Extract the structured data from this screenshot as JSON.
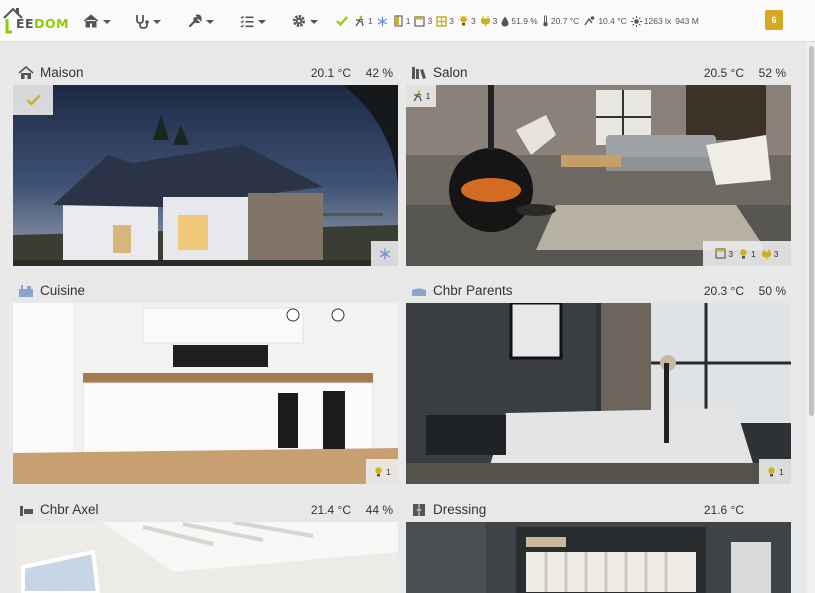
{
  "app": {
    "logo_text_first": "EE",
    "logo_text_rest": "DOM"
  },
  "navbar": {
    "menus": [
      {
        "icon": "home-icon"
      },
      {
        "icon": "stethoscope-icon"
      },
      {
        "icon": "wrench-icon"
      },
      {
        "icon": "checklist-icon"
      },
      {
        "icon": "gear-icon"
      }
    ],
    "summary": {
      "motion_count": "1",
      "door_count": "1",
      "window_count": "3",
      "shutter_count": "3",
      "light_count": "3",
      "outlet_count": "3",
      "humidity": "51.9 %",
      "temperature": "20.7 °C",
      "outdoor_temperature": "10.4 °C",
      "luminosity": "1263 lx",
      "pressure": "943 M"
    },
    "notifications_count": "6"
  },
  "rooms": [
    {
      "name": "Maison",
      "temperature": "20.1 °C",
      "humidity": "42 %"
    },
    {
      "name": "Salon",
      "temperature": "20.5 °C",
      "humidity": "52 %",
      "motion_count": "1",
      "window_count": "3",
      "light_count": "1",
      "outlet_count": "3"
    },
    {
      "name": "Cuisine",
      "temperature": "",
      "humidity": "",
      "light_count": "1"
    },
    {
      "name": "Chbr Parents",
      "temperature": "20.3 °C",
      "humidity": "50 %",
      "light_count": "1"
    },
    {
      "name": "Chbr Axel",
      "temperature": "21.4 °C",
      "humidity": "44 %"
    },
    {
      "name": "Dressing",
      "temperature": "21.6 °C",
      "humidity": ""
    }
  ],
  "colors": {
    "accent": "#94ca02",
    "badge": "#d6a723",
    "icon_yellow": "#c9b21f",
    "snow_blue": "#6b8fd6"
  }
}
